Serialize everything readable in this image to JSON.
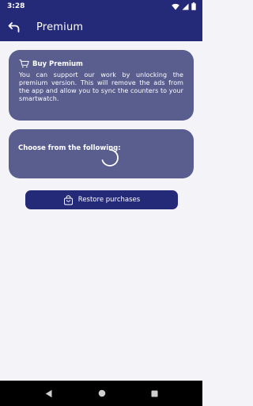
{
  "status_bar": {
    "time": "3:28"
  },
  "app_bar": {
    "title": "Premium"
  },
  "buy_card": {
    "title": "Buy Premium",
    "description": "You can support our work by unlocking the premium version. This will remove the ads from the app and allow you to sync the counters to your smartwatch."
  },
  "options_card": {
    "title": "Choose from the following:"
  },
  "restore_button": {
    "label": "Restore purchases"
  },
  "colors": {
    "primary": "#242a78",
    "card": "#5a5e8f",
    "background": "#f3f3f8"
  },
  "icons": {
    "back": "arrow-back-icon",
    "cart": "cart-icon",
    "bag": "shopping-bag-icon",
    "wifi": "wifi-icon",
    "signal": "signal-icon",
    "battery": "battery-icon"
  }
}
